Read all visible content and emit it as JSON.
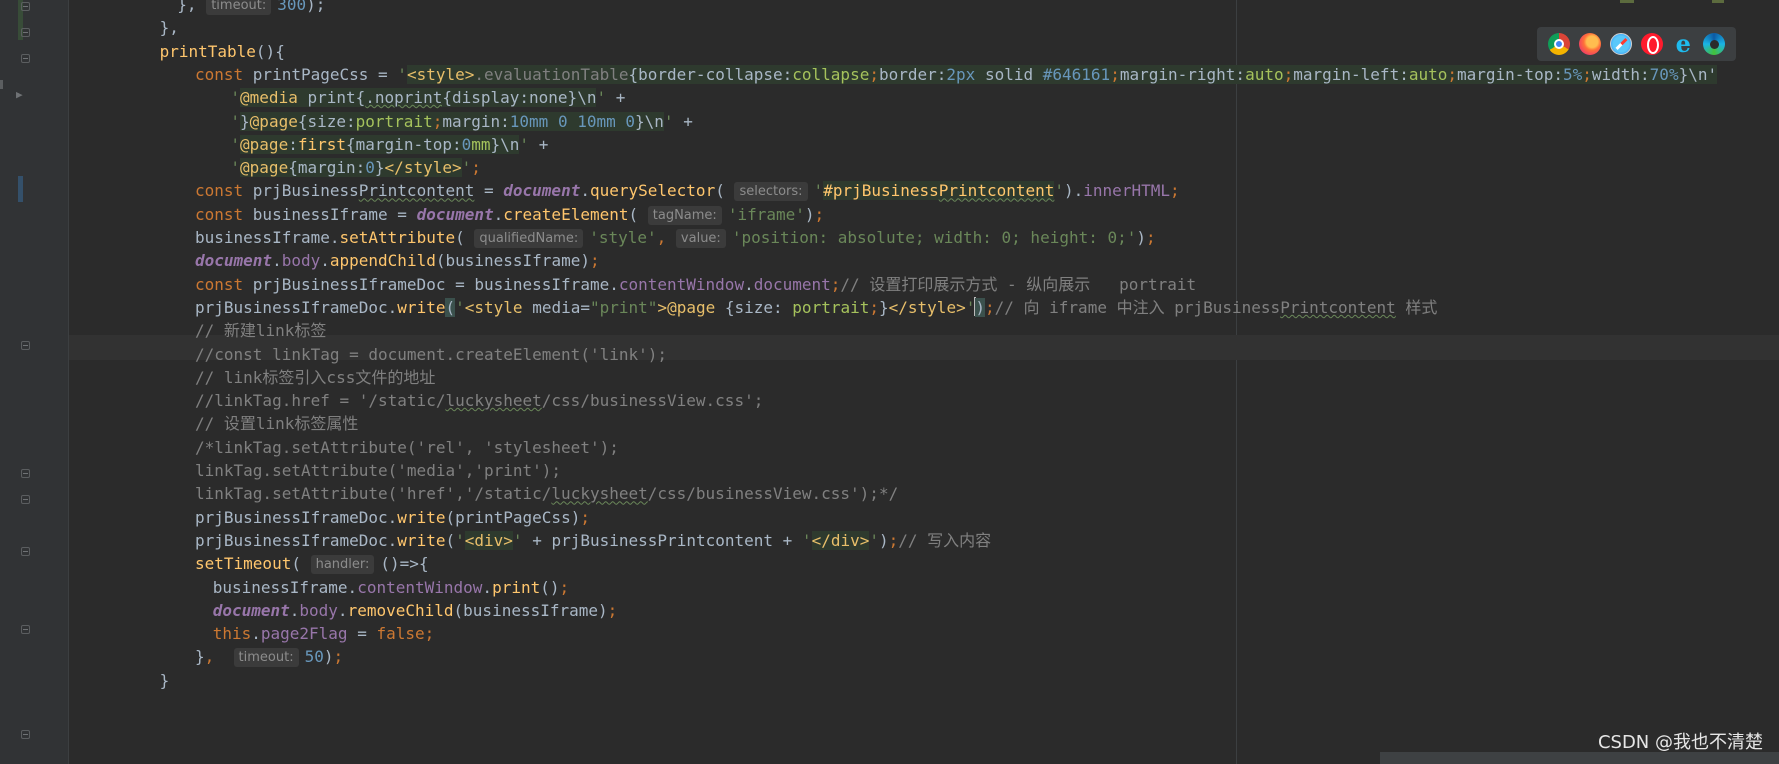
{
  "lines": [
    {
      "indent": 9,
      "tokens": [
        {
          "c": "t",
          "v": "}, "
        },
        {
          "c": "hint",
          "v": "timeout:"
        },
        {
          "c": "n",
          "v": "300"
        },
        {
          "c": "t",
          "v": ");"
        }
      ]
    },
    {
      "indent": 8,
      "tokens": [
        {
          "c": "t",
          "v": "},"
        }
      ]
    },
    {
      "indent": 8,
      "tokens": [
        {
          "c": "fn",
          "v": "printTable"
        },
        {
          "c": "t",
          "v": "(){"
        }
      ]
    },
    {
      "indent": 10,
      "tokens": [
        {
          "c": "k",
          "v": "const "
        },
        {
          "c": "t",
          "v": "printPageCss = "
        },
        {
          "c": "s",
          "v": "'"
        },
        {
          "c": "tag sbg",
          "v": "<style>"
        },
        {
          "c": "c sbg",
          "v": ".evaluationTable"
        },
        {
          "c": "t sbg",
          "v": "{border-collapse:"
        },
        {
          "c": "cssv sbg",
          "v": "collapse"
        },
        {
          "c": "k sbg",
          "v": ";"
        },
        {
          "c": "t sbg",
          "v": "border:"
        },
        {
          "c": "n sbg",
          "v": "2px"
        },
        {
          "c": "t sbg",
          "v": " solid "
        },
        {
          "c": "n sbg",
          "v": "#646161"
        },
        {
          "c": "k sbg",
          "v": ";"
        },
        {
          "c": "t sbg",
          "v": "margin-right:"
        },
        {
          "c": "cssv sbg",
          "v": "auto"
        },
        {
          "c": "k sbg",
          "v": ";"
        },
        {
          "c": "t sbg",
          "v": "margin-left:"
        },
        {
          "c": "cssv sbg",
          "v": "auto"
        },
        {
          "c": "k sbg",
          "v": ";"
        },
        {
          "c": "t sbg",
          "v": "margin-top:"
        },
        {
          "c": "n sbg",
          "v": "5%"
        },
        {
          "c": "k sbg",
          "v": ";"
        },
        {
          "c": "t sbg",
          "v": "width:"
        },
        {
          "c": "n sbg",
          "v": "70%"
        },
        {
          "c": "t sbg",
          "v": "}\\n'"
        }
      ]
    },
    {
      "indent": 12,
      "tokens": [
        {
          "c": "s",
          "v": "'"
        },
        {
          "c": "tag sbg",
          "v": "@media "
        },
        {
          "c": "t sbg",
          "v": "print{"
        },
        {
          "c": "t sbg u",
          "v": ".noprint"
        },
        {
          "c": "t sbg",
          "v": "{display:none}\\n"
        },
        {
          "c": "s",
          "v": "' "
        },
        {
          "c": "t",
          "v": "+"
        }
      ]
    },
    {
      "indent": 12,
      "tokens": [
        {
          "c": "s",
          "v": "'"
        },
        {
          "c": "t sbg",
          "v": "}"
        },
        {
          "c": "tag sbg",
          "v": "@page"
        },
        {
          "c": "t sbg",
          "v": "{size:"
        },
        {
          "c": "cssv sbg",
          "v": "portrait"
        },
        {
          "c": "k sbg",
          "v": ";"
        },
        {
          "c": "t sbg",
          "v": "margin:"
        },
        {
          "c": "n sbg",
          "v": "10mm 0 10mm 0"
        },
        {
          "c": "t sbg",
          "v": "}\\n"
        },
        {
          "c": "s",
          "v": "' "
        },
        {
          "c": "t",
          "v": "+"
        }
      ]
    },
    {
      "indent": 12,
      "tokens": [
        {
          "c": "s",
          "v": "'"
        },
        {
          "c": "tag sbg",
          "v": "@page"
        },
        {
          "c": "t sbg",
          "v": ":"
        },
        {
          "c": "fn sbg",
          "v": "first"
        },
        {
          "c": "t sbg",
          "v": "{margin-top:"
        },
        {
          "c": "n sbg",
          "v": "0"
        },
        {
          "c": "cssv sbg",
          "v": "mm"
        },
        {
          "c": "t sbg",
          "v": "}\\n"
        },
        {
          "c": "s",
          "v": "' "
        },
        {
          "c": "t",
          "v": "+"
        }
      ]
    },
    {
      "indent": 12,
      "tokens": [
        {
          "c": "s",
          "v": "'"
        },
        {
          "c": "tag sbg",
          "v": "@page"
        },
        {
          "c": "t sbg",
          "v": "{margin:"
        },
        {
          "c": "n sbg",
          "v": "0"
        },
        {
          "c": "t sbg",
          "v": "}"
        },
        {
          "c": "tag sbg",
          "v": "</style>"
        },
        {
          "c": "s",
          "v": "'"
        },
        {
          "c": "k",
          "v": ";"
        }
      ]
    },
    {
      "indent": 10,
      "tokens": [
        {
          "c": "k",
          "v": "const "
        },
        {
          "c": "t",
          "v": "prjBusiness"
        },
        {
          "c": "t u",
          "v": "Printcontent"
        },
        {
          "c": "t",
          "v": " = "
        },
        {
          "c": "pi",
          "v": "document"
        },
        {
          "c": "t",
          "v": "."
        },
        {
          "c": "fn",
          "v": "querySelector"
        },
        {
          "c": "t",
          "v": "( "
        },
        {
          "c": "hint",
          "v": "selectors:"
        },
        {
          "c": "s",
          "v": "'"
        },
        {
          "c": "fn sbg",
          "v": "#prjBusiness"
        },
        {
          "c": "fn sbg u",
          "v": "Printcontent"
        },
        {
          "c": "s",
          "v": "'"
        },
        {
          "c": "t",
          "v": ")."
        },
        {
          "c": "p",
          "v": "innerHTML"
        },
        {
          "c": "k",
          "v": ";"
        }
      ]
    },
    {
      "indent": 10,
      "tokens": [
        {
          "c": "k",
          "v": "const "
        },
        {
          "c": "t",
          "v": "businessIframe = "
        },
        {
          "c": "pi",
          "v": "document"
        },
        {
          "c": "t",
          "v": "."
        },
        {
          "c": "fn",
          "v": "createElement"
        },
        {
          "c": "t",
          "v": "( "
        },
        {
          "c": "hint",
          "v": "tagName:"
        },
        {
          "c": "s",
          "v": "'iframe'"
        },
        {
          "c": "t",
          "v": ")"
        },
        {
          "c": "k",
          "v": ";"
        }
      ]
    },
    {
      "indent": 10,
      "tokens": [
        {
          "c": "t",
          "v": "businessIframe."
        },
        {
          "c": "fn",
          "v": "setAttribute"
        },
        {
          "c": "t",
          "v": "( "
        },
        {
          "c": "hint",
          "v": "qualifiedName:"
        },
        {
          "c": "s",
          "v": "'style'"
        },
        {
          "c": "k",
          "v": ", "
        },
        {
          "c": "hint",
          "v": "value:"
        },
        {
          "c": "s",
          "v": "'position: absolute; width: 0; height: 0;'"
        },
        {
          "c": "t",
          "v": ")"
        },
        {
          "c": "k",
          "v": ";"
        }
      ]
    },
    {
      "indent": 10,
      "tokens": [
        {
          "c": "pi",
          "v": "document"
        },
        {
          "c": "t",
          "v": "."
        },
        {
          "c": "p",
          "v": "body"
        },
        {
          "c": "t",
          "v": "."
        },
        {
          "c": "fn",
          "v": "appendChild"
        },
        {
          "c": "t",
          "v": "(businessIframe)"
        },
        {
          "c": "k",
          "v": ";"
        }
      ]
    },
    {
      "indent": 10,
      "tokens": [
        {
          "c": "k",
          "v": "const "
        },
        {
          "c": "t",
          "v": "prjBusinessIframeDoc = businessIframe."
        },
        {
          "c": "p",
          "v": "contentWindow"
        },
        {
          "c": "t",
          "v": "."
        },
        {
          "c": "p",
          "v": "document"
        },
        {
          "c": "k",
          "v": ";"
        },
        {
          "c": "c",
          "v": "// 设置打印展示方式 - 纵向展示   portrait"
        }
      ]
    },
    {
      "indent": 10,
      "caret": true,
      "tokens": [
        {
          "c": "t",
          "v": "prjBusinessIframeDoc."
        },
        {
          "c": "fn",
          "v": "write"
        },
        {
          "c": "t brace-hl",
          "v": "("
        },
        {
          "c": "s",
          "v": "'"
        },
        {
          "c": "tag",
          "v": "<style "
        },
        {
          "c": "t",
          "v": "media="
        },
        {
          "c": "s",
          "v": "\"print\""
        },
        {
          "c": "tag",
          "v": ">"
        },
        {
          "c": "tag",
          "v": "@page "
        },
        {
          "c": "t",
          "v": "{size: "
        },
        {
          "c": "cssv",
          "v": "portrait"
        },
        {
          "c": "k",
          "v": ";"
        },
        {
          "c": "t",
          "v": "}"
        },
        {
          "c": "tag",
          "v": "</style>"
        },
        {
          "c": "s",
          "v": "'"
        },
        {
          "c": "cursor",
          "v": ""
        },
        {
          "c": "t brace-hl",
          "v": ")"
        },
        {
          "c": "k",
          "v": ";"
        },
        {
          "c": "c",
          "v": "// 向 iframe 中注入 prjBusiness"
        },
        {
          "c": "c u",
          "v": "Printcontent"
        },
        {
          "c": "c",
          "v": " 样式"
        }
      ]
    },
    {
      "indent": 10,
      "tokens": [
        {
          "c": "c",
          "v": "// 新建link标签"
        }
      ]
    },
    {
      "indent": 10,
      "tokens": [
        {
          "c": "c",
          "v": "//const linkTag = document.createElement('link');"
        }
      ]
    },
    {
      "indent": 10,
      "tokens": [
        {
          "c": "c",
          "v": "// link标签引入css文件的地址"
        }
      ]
    },
    {
      "indent": 10,
      "tokens": [
        {
          "c": "c",
          "v": "//linkTag.href = '/static/"
        },
        {
          "c": "c u",
          "v": "luckysheet"
        },
        {
          "c": "c",
          "v": "/css/businessView.css';"
        }
      ]
    },
    {
      "indent": 10,
      "tokens": [
        {
          "c": "c",
          "v": "// 设置link标签属性"
        }
      ]
    },
    {
      "indent": 10,
      "tokens": [
        {
          "c": "c",
          "v": "/*linkTag.setAttribute('rel', 'stylesheet');"
        }
      ]
    },
    {
      "indent": 10,
      "tokens": [
        {
          "c": "c",
          "v": "linkTag.setAttribute('media','print');"
        }
      ]
    },
    {
      "indent": 10,
      "tokens": [
        {
          "c": "c",
          "v": "linkTag.setAttribute('href','/static/"
        },
        {
          "c": "c u",
          "v": "luckysheet"
        },
        {
          "c": "c",
          "v": "/css/businessView.css');*/"
        }
      ]
    },
    {
      "indent": 10,
      "tokens": [
        {
          "c": "t",
          "v": "prjBusinessIframeDoc."
        },
        {
          "c": "fn",
          "v": "write"
        },
        {
          "c": "t",
          "v": "(printPageCss)"
        },
        {
          "c": "k",
          "v": ";"
        }
      ]
    },
    {
      "indent": 10,
      "tokens": [
        {
          "c": "t",
          "v": "prjBusinessIframeDoc."
        },
        {
          "c": "fn",
          "v": "write"
        },
        {
          "c": "t",
          "v": "("
        },
        {
          "c": "s",
          "v": "'"
        },
        {
          "c": "tag sbg",
          "v": "<div>"
        },
        {
          "c": "s",
          "v": "'"
        },
        {
          "c": "t",
          "v": " + prjBusinessPrintcontent + "
        },
        {
          "c": "s",
          "v": "'"
        },
        {
          "c": "tag sbg",
          "v": "</div>"
        },
        {
          "c": "s",
          "v": "'"
        },
        {
          "c": "t",
          "v": ")"
        },
        {
          "c": "k",
          "v": ";"
        },
        {
          "c": "c",
          "v": "// 写入内容"
        }
      ]
    },
    {
      "indent": 10,
      "tokens": [
        {
          "c": "fn",
          "v": "setTimeout"
        },
        {
          "c": "t",
          "v": "( "
        },
        {
          "c": "hint",
          "v": "handler:"
        },
        {
          "c": "t",
          "v": "()=>{"
        }
      ]
    },
    {
      "indent": 11,
      "tokens": [
        {
          "c": "t",
          "v": "businessIframe."
        },
        {
          "c": "p",
          "v": "contentWindow"
        },
        {
          "c": "t",
          "v": "."
        },
        {
          "c": "fn",
          "v": "print"
        },
        {
          "c": "t",
          "v": "()"
        },
        {
          "c": "k",
          "v": ";"
        }
      ]
    },
    {
      "indent": 11,
      "tokens": [
        {
          "c": "pi",
          "v": "document"
        },
        {
          "c": "t",
          "v": "."
        },
        {
          "c": "p",
          "v": "body"
        },
        {
          "c": "t",
          "v": "."
        },
        {
          "c": "fn",
          "v": "removeChild"
        },
        {
          "c": "t",
          "v": "(businessIframe)"
        },
        {
          "c": "k",
          "v": ";"
        }
      ]
    },
    {
      "indent": 11,
      "tokens": [
        {
          "c": "k",
          "v": "this"
        },
        {
          "c": "t",
          "v": "."
        },
        {
          "c": "p",
          "v": "page2Flag"
        },
        {
          "c": "t",
          "v": " = "
        },
        {
          "c": "k",
          "v": "false;"
        }
      ]
    },
    {
      "indent": 10,
      "tokens": [
        {
          "c": "t",
          "v": "}"
        },
        {
          "c": "k",
          "v": ",  "
        },
        {
          "c": "hint",
          "v": "timeout:"
        },
        {
          "c": "n",
          "v": "50"
        },
        {
          "c": "t",
          "v": ")"
        },
        {
          "c": "k",
          "v": ";"
        }
      ]
    },
    {
      "indent": 8,
      "tokens": [
        {
          "c": "t",
          "v": "}"
        }
      ]
    }
  ],
  "browsers": [
    "chrome-icon",
    "firefox-icon",
    "safari-icon",
    "opera-icon",
    "ie-icon",
    "edge-icon"
  ],
  "ie_glyph": "e",
  "watermark": "CSDN @我也不清楚"
}
